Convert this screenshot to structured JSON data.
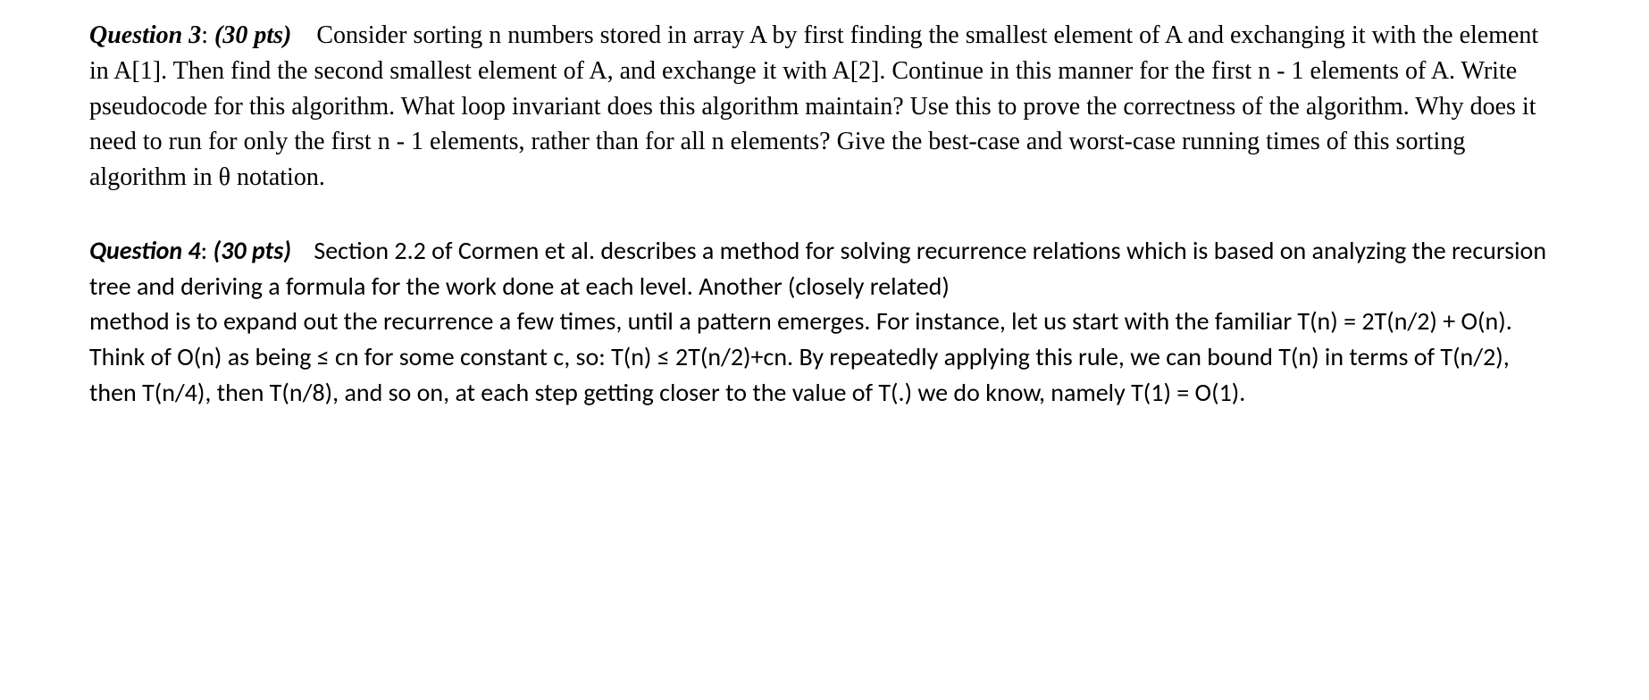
{
  "questions": [
    {
      "label": "Question 3",
      "points": "(30 pts)",
      "body": "Consider sorting n numbers stored in array A by first finding the smallest element of A and exchanging it with the element in A[1]. Then find the second smallest element of A, and exchange it with A[2]. Continue in this manner for the first n - 1 elements of A. Write pseudocode for this algorithm. What loop invariant does this algorithm maintain? Use this to prove the correctness of the algorithm. Why does it need to run for only the first n - 1 elements, rather than for all n elements? Give the best-case and worst-case running times of this sorting algorithm in θ notation."
    },
    {
      "label": "Question 4",
      "points": "(30 pts)",
      "body": "Section 2.2 of Cormen et al. describes a method for solving recurrence relations which is based on analyzing the recursion tree and deriving a formula for the work done at each level. Another (closely related)\nmethod is to expand out the recurrence a few times, until a pattern emerges. For instance, let us start with the familiar T(n) = 2T(n/2) + O(n). Think of O(n) as being ≤ cn for some constant c, so: T(n) ≤ 2T(n/2)+cn. By repeatedly applying this rule, we can bound T(n) in terms of T(n/2), then T(n/4), then T(n/8), and so on, at each step getting closer to the value of T(.) we do know, namely T(1) = O(1)."
    }
  ]
}
